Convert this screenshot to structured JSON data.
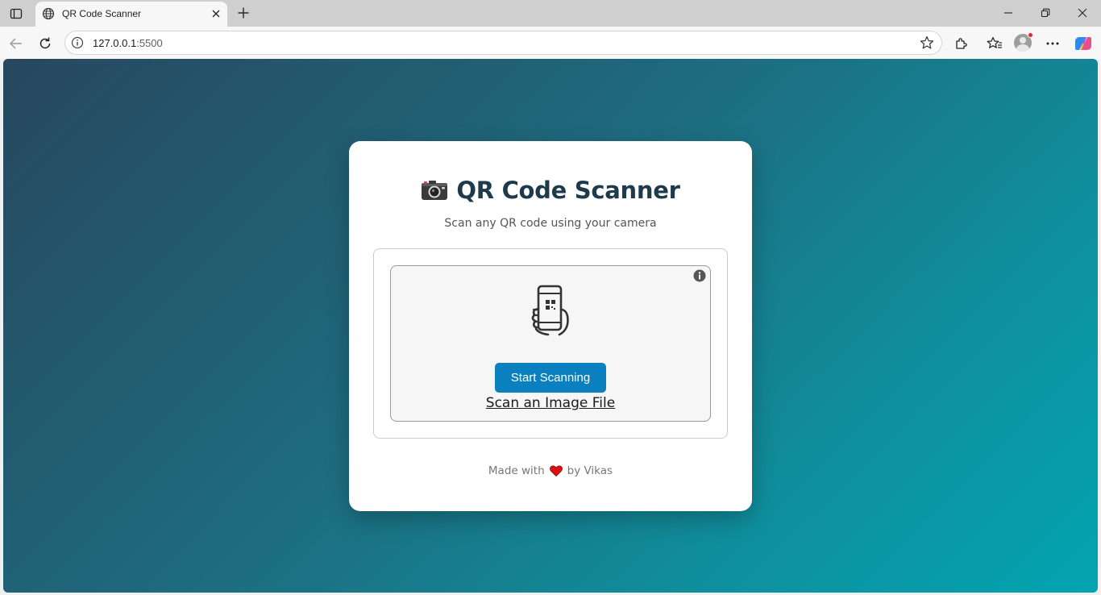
{
  "browser": {
    "tab": {
      "title": "QR Code Scanner"
    },
    "address": {
      "host": "127.0.0.1",
      "port": ":5500"
    }
  },
  "page": {
    "title_emoji": "📷",
    "title": "QR Code Scanner",
    "subtitle": "Scan any QR code using your camera",
    "start_button_label": "Start Scanning",
    "scan_file_link": "Scan an Image File",
    "footer": {
      "prefix": "Made with",
      "suffix": "by Vikas"
    }
  },
  "colors": {
    "primary_button": "#0b80bf",
    "title_text": "#1f3a4b",
    "gradient_start": "#27475e",
    "gradient_end": "#03a4b1",
    "heart": "#e01010"
  },
  "icons": {
    "tab_sidebar": "sidebar-toggle-icon",
    "tab": "globe-icon",
    "tab_close": "close-icon",
    "new_tab": "plus-icon",
    "back": "arrow-left-icon",
    "reload": "reload-icon",
    "site_info": "info-icon",
    "favorite": "star-icon",
    "extensions": "puzzle-icon",
    "favorites": "favorites-icon",
    "more": "ellipsis-icon",
    "copilot": "copilot-icon",
    "scanner_info": "info-circle-icon",
    "scanner": "phone-qr-icon",
    "heart": "heart-icon"
  }
}
